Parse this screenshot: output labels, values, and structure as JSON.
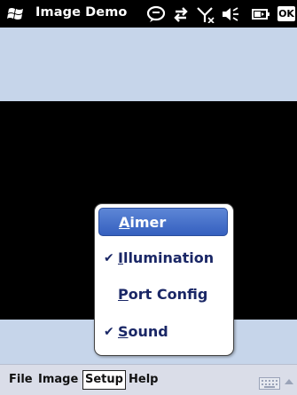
{
  "titlebar": {
    "title": "Image Demo",
    "ok_label": "OK"
  },
  "menubar": {
    "items": [
      "File",
      "Image",
      "Setup",
      "Help"
    ],
    "active": "Setup"
  },
  "popup": {
    "items": [
      {
        "label": "Aimer",
        "checked": false,
        "selected": true
      },
      {
        "label": "Illumination",
        "checked": true,
        "selected": false
      },
      {
        "label": "Port Config",
        "checked": false,
        "selected": false
      },
      {
        "label": "Sound",
        "checked": true,
        "selected": false
      }
    ],
    "check_glyph": "✔"
  },
  "colors": {
    "titlebar_bg": "#000000",
    "client_bg": "#c6d5ea",
    "image_bg": "#000000",
    "menu_text": "#1a2766",
    "selected_bg": "#3f69c8"
  },
  "icons": [
    "windows-flag-icon",
    "chat-bubble-icon",
    "connectivity-arrows-icon",
    "no-signal-icon",
    "volume-icon",
    "battery-icon",
    "keyboard-icon",
    "up-arrow-icon"
  ]
}
